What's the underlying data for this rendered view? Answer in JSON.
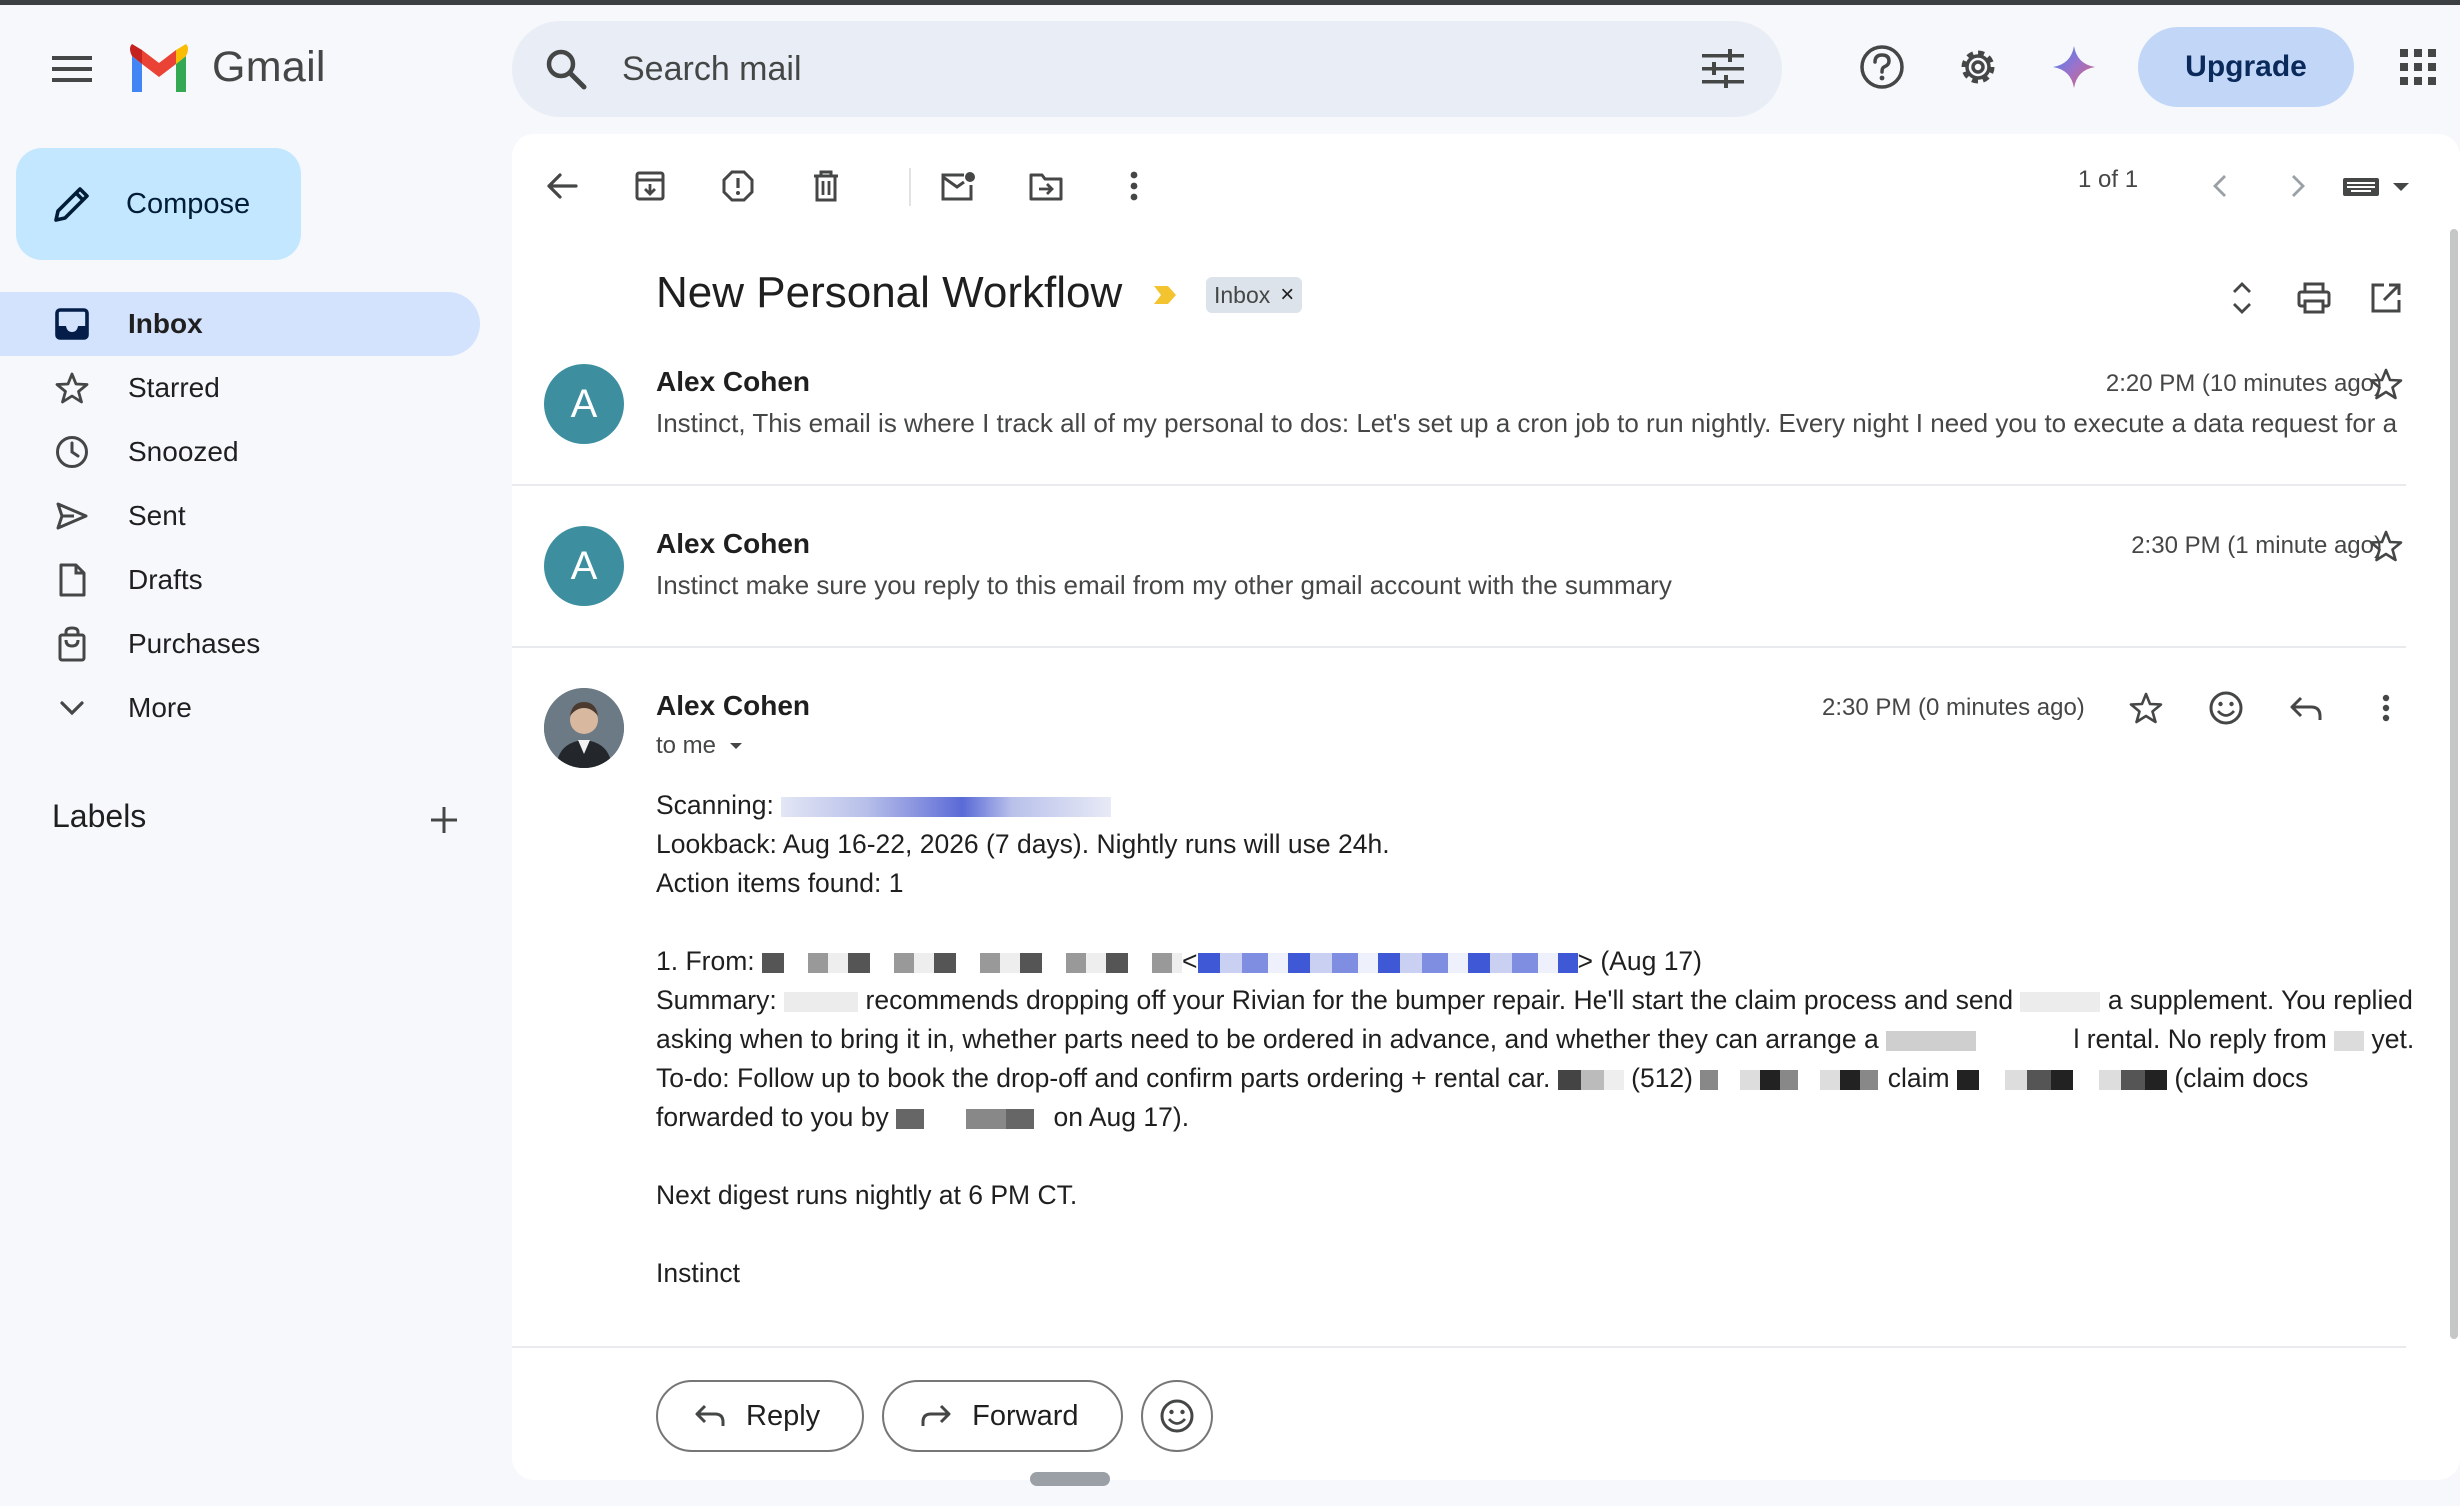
{
  "app": {
    "name": "Gmail"
  },
  "header": {
    "search_placeholder": "Search mail",
    "upgrade_label": "Upgrade"
  },
  "sidebar": {
    "compose_label": "Compose",
    "items": [
      {
        "label": "Inbox",
        "icon": "inbox-icon",
        "active": true
      },
      {
        "label": "Starred",
        "icon": "star-icon"
      },
      {
        "label": "Snoozed",
        "icon": "clock-icon"
      },
      {
        "label": "Sent",
        "icon": "send-icon"
      },
      {
        "label": "Drafts",
        "icon": "file-icon"
      },
      {
        "label": "Purchases",
        "icon": "bag-icon"
      },
      {
        "label": "More",
        "icon": "chevron-down-icon"
      }
    ],
    "labels_title": "Labels"
  },
  "toolbar": {
    "pager": "1 of 1"
  },
  "thread": {
    "subject": "New Personal Workflow",
    "label_chip": "Inbox",
    "label_chip_close": "×",
    "messages": [
      {
        "sender": "Alex Cohen",
        "avatar_letter": "A",
        "time": "2:20 PM (10 minutes ago)",
        "snippet": "Instinct, This email is where I track all of my personal to dos: Let's set up a cron job to run nightly. Every night I need you to execute a data request for a"
      },
      {
        "sender": "Alex Cohen",
        "avatar_letter": "A",
        "time": "2:30 PM (1 minute ago)",
        "snippet": "Instinct make sure you reply to this email from my other gmail account with the summary"
      },
      {
        "sender": "Alex Cohen",
        "time": "2:30 PM (0 minutes ago)",
        "to": "to me",
        "body": {
          "scanning": "Scanning:",
          "lookback": "Lookback: Aug 16-22, 2026 (7 days). Nightly runs will use 24h.",
          "action_items": "Action items found: 1",
          "from_prefix": "1. From:",
          "from_lt": "<",
          "from_suffix": "> (Aug 17)",
          "summary_a": "Summary:",
          "summary_b": "recommends dropping off your Rivian for the bumper repair. He'll start the claim process and send",
          "summary_c": "a supplement. You replied asking when to bring it in, whether parts need to be ordered in advance, and whether they can arrange a",
          "summary_d": "l rental. No reply from",
          "summary_e": "yet.",
          "todo_a": "To-do: Follow up to book the drop-off and confirm parts ordering + rental car.",
          "todo_b": "(512)",
          "todo_c": "claim",
          "todo_d": "(claim docs forwarded to you by",
          "todo_e": "on Aug 17).",
          "next_digest": "Next digest runs nightly at 6 PM CT.",
          "signature": "Instinct"
        }
      }
    ],
    "reply_label": "Reply",
    "forward_label": "Forward"
  }
}
